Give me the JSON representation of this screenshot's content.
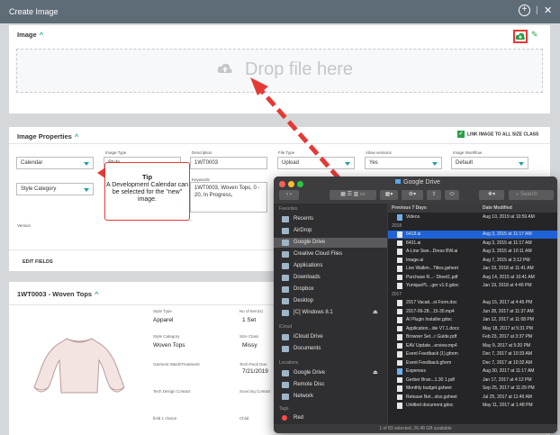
{
  "window": {
    "title": "Create Image"
  },
  "image_section": {
    "title": "Image",
    "drop_text": "Drop file here"
  },
  "properties_section": {
    "title": "Image Properties",
    "link_label": "LINK IMAGE TO ALL SIZE CLASS",
    "edit_fields": "EDIT FIELDS",
    "fields": {
      "image_type_label": "Image Type",
      "description_label": "Description",
      "description_value": "1WT0003",
      "file_type_label": "File Type",
      "file_type_value": "Upload",
      "allow_versions_label": "Allow versions",
      "allow_versions_value": "Yes",
      "workflow_label": "Image Workflow",
      "workflow_value": "Default",
      "calendar_value": "Calendar",
      "image_type_value": "Style",
      "style_category_value": "Style Category",
      "keywords_label": "Keywords",
      "keywords_value": "1WT0003, Woven Tops, 0 - 20, In Progress,",
      "version_label": "Version"
    }
  },
  "tip": {
    "title": "Tip",
    "body": "A Development Calendar can be selected for the \"new\" image."
  },
  "style_section": {
    "title": "1WT0003 - Woven Tops",
    "details": [
      {
        "label": "Style Type",
        "value": "Apparel"
      },
      {
        "label": "No of Item(s)",
        "value": "1 Set"
      },
      {
        "label": "Style Category",
        "value": "Woven Tops"
      },
      {
        "label": "Size Class",
        "value": "Missy"
      },
      {
        "label": "Garment Wash/Treatment",
        "value": ""
      },
      {
        "label": "Tech-Pack Due",
        "value": "7/21/2019"
      },
      {
        "label": "Tech Design Contact",
        "value": ""
      },
      {
        "label": "Sourcing Contact",
        "value": ""
      },
      {
        "label": "field 1 choice",
        "value": ""
      },
      {
        "label": "Child",
        "value": ""
      }
    ]
  },
  "finder": {
    "title": "Google Drive",
    "search_placeholder": "Search",
    "sidebar": {
      "favorites_head": "Favorites",
      "favorites": [
        "Recents",
        "AirDrop",
        "Google Drive",
        "Creative Cloud Files",
        "Applications",
        "Downloads",
        "Dropbox",
        "Desktop",
        "[C] Windows 8.1"
      ],
      "icloud_head": "iCloud",
      "icloud": [
        "iCloud Drive",
        "Documents"
      ],
      "locations_head": "Locations",
      "locations": [
        "Google Drive",
        "Remote Disc",
        "Network"
      ],
      "tags_head": "Tags",
      "tags": [
        "Red"
      ]
    },
    "columns": {
      "name": "Previous 7 Days",
      "date": "Date Modified"
    },
    "rows": [
      {
        "name": "Videos",
        "date": "Aug 10, 2019 at 10:59 AM",
        "type": "folder"
      },
      {
        "name": "2018",
        "date": "",
        "type": "group"
      },
      {
        "name": "6418.ai",
        "date": "Aug 3, 2015 at 11:17 AM",
        "type": "file",
        "selected": true
      },
      {
        "name": "6431.ai",
        "date": "Aug 3, 2015 at 11:17 AM",
        "type": "file"
      },
      {
        "name": "A-Line Swe...Dress BW.ai",
        "date": "Aug 3, 2015 at 10:11 AM",
        "type": "file"
      },
      {
        "name": "Image.ai",
        "date": "Aug 7, 2015 at 3:12 PM",
        "type": "file"
      },
      {
        "name": "Live Walkm...Titles.gsheet",
        "date": "Jan 19, 2018 at 11:41 AM",
        "type": "file"
      },
      {
        "name": "Purchase R...- Sheet1.pdf",
        "date": "Aug 14, 2015 at 10:41 AM",
        "type": "file"
      },
      {
        "name": "YuniquePL...ger v1.0.gdoc",
        "date": "Jan 19, 2018 at 4:46 PM",
        "type": "file"
      },
      {
        "name": "2017",
        "date": "",
        "type": "group"
      },
      {
        "name": "2017 Vacati...st Form.doc",
        "date": "Aug 15, 2017 at 4:45 PM",
        "type": "file"
      },
      {
        "name": "2017-06-28...15-30.mp4",
        "date": "Jun 28, 2017 at 11:37 AM",
        "type": "file"
      },
      {
        "name": "AI Plugin Installer.gdoc",
        "date": "Jan 12, 2017 at 11:08 PM",
        "type": "file"
      },
      {
        "name": "Application...ide V7.1.docx",
        "date": "May 18, 2017 at 5:31 PM",
        "type": "file"
      },
      {
        "name": "Browser Set...r Guide.pdf",
        "date": "Feb 23, 2017 at 3:37 PM",
        "type": "file"
      },
      {
        "name": "EAV Update...erview.mp4",
        "date": "May 9, 2017 at 5:20 PM",
        "type": "file"
      },
      {
        "name": "Event Feedback (1).gform",
        "date": "Dec 7, 2017 at 10:33 AM",
        "type": "file"
      },
      {
        "name": "Event Feedback.gform",
        "date": "Dec 7, 2017 at 10:32 AM",
        "type": "file"
      },
      {
        "name": "Expenses",
        "date": "Aug 30, 2017 at 11:17 AM",
        "type": "folder"
      },
      {
        "name": "Gerber Bran...1.30 1.pdf",
        "date": "Jan 17, 2017 at 4:12 PM",
        "type": "file"
      },
      {
        "name": "Monthly budget.gsheet",
        "date": "Sep 25, 2017 at 11:29 PM",
        "type": "file"
      },
      {
        "name": "Release Not...xlsx.gsheet",
        "date": "Jul 25, 2017 at 11:49 AM",
        "type": "file"
      },
      {
        "name": "Untitled document.gdoc",
        "date": "May 11, 2017 at 1:48 PM",
        "type": "file"
      }
    ],
    "status": "1 of 83 selected, 26.48 GB available"
  }
}
